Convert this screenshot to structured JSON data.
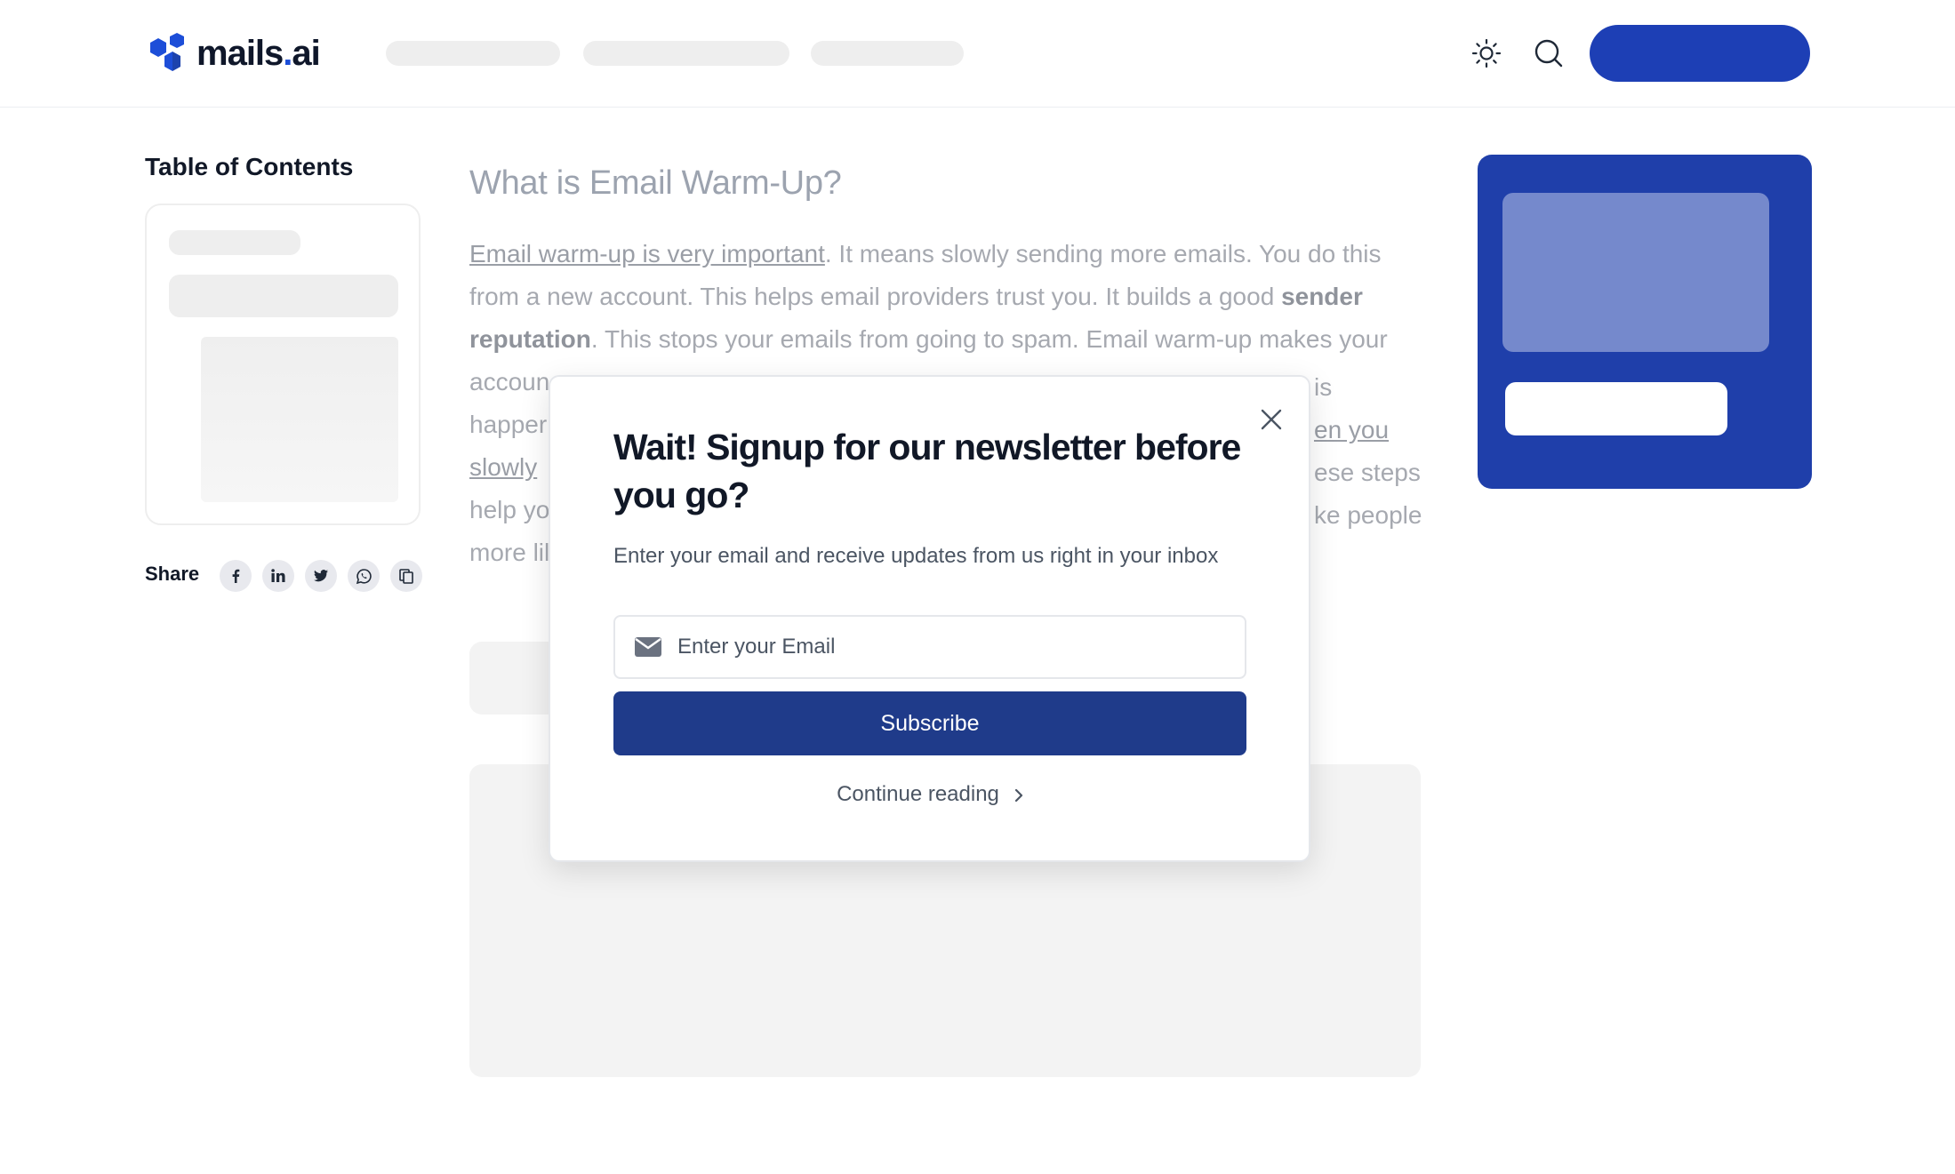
{
  "header": {
    "logo": {
      "text_main": "mails",
      "text_dot": ".",
      "text_suffix": "ai",
      "brand_color": "#1d4ed8"
    },
    "icons": [
      "sun-icon",
      "search-icon"
    ]
  },
  "sidebar": {
    "toc_title": "Table of Contents",
    "share_label": "Share",
    "share_icons": [
      "facebook-icon",
      "linkedin-icon",
      "twitter-icon",
      "whatsapp-icon",
      "copy-icon"
    ]
  },
  "article": {
    "heading": "What is Email Warm-Up?",
    "p1_link": "Email warm-up is very important",
    "p1_text1": ". It means slowly sending more emails. You do this from a new account. This helps email providers trust you. It builds a good ",
    "p1_bold": "sender reputation",
    "p1_text2": ". This stops your emails from going to spam. Email warm-up makes your accoun",
    "line5_start": "happer",
    "line5_end_link": "en you",
    "line6_start_link": "slowly",
    "line6_end": "ese steps",
    "line7_start": "help yo",
    "line7_end": "ke people",
    "line8_start": "more lil",
    "line4_end": "is"
  },
  "modal": {
    "title": "Wait! Signup for our newsletter before you go?",
    "subtitle": "Enter your email and receive updates from us right in your inbox",
    "email_placeholder": "Enter your Email",
    "subscribe_label": "Subscribe",
    "continue_label": "Continue reading"
  },
  "colors": {
    "primary": "#1f3b8a",
    "promo_bg": "#1f3faa",
    "cta": "#1d3fb5"
  }
}
